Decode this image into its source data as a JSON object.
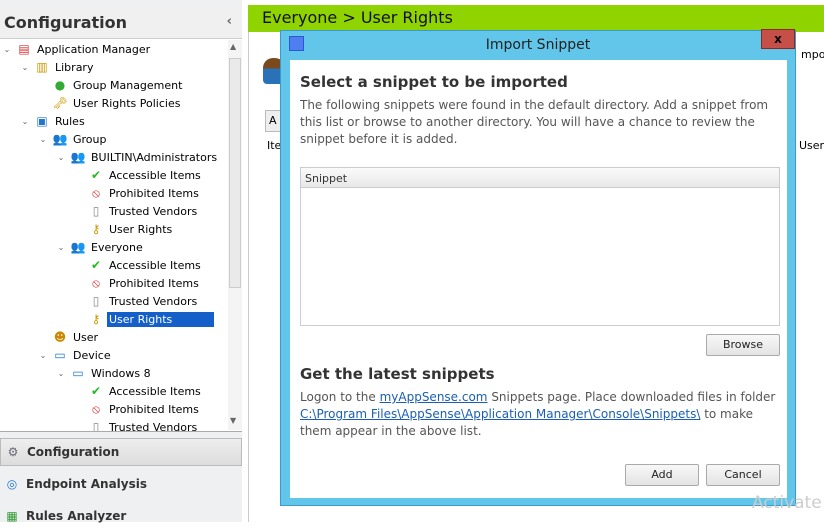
{
  "left_panel": {
    "title": "Configuration",
    "collapse_icon": "chevron-left-icon",
    "tree": [
      {
        "level": 0,
        "chev": true,
        "icon": "app-manager-icon",
        "label": "Application Manager"
      },
      {
        "level": 1,
        "chev": true,
        "icon": "library-icon",
        "label": "Library"
      },
      {
        "level": 2,
        "chev": false,
        "icon": "group-management-icon",
        "label": "Group Management"
      },
      {
        "level": 2,
        "chev": false,
        "icon": "user-rights-policies-icon",
        "label": "User Rights Policies"
      },
      {
        "level": 1,
        "chev": true,
        "icon": "rules-icon",
        "label": "Rules"
      },
      {
        "level": 2,
        "chev": true,
        "icon": "group-icon",
        "label": "Group"
      },
      {
        "level": 3,
        "chev": true,
        "icon": "group-icon",
        "label": "BUILTIN\\Administrators"
      },
      {
        "level": 4,
        "chev": false,
        "icon": "check-icon",
        "label": "Accessible Items"
      },
      {
        "level": 4,
        "chev": false,
        "icon": "prohibited-icon",
        "label": "Prohibited Items"
      },
      {
        "level": 4,
        "chev": false,
        "icon": "certificate-icon",
        "label": "Trusted Vendors"
      },
      {
        "level": 4,
        "chev": false,
        "icon": "user-key-icon",
        "label": "User Rights"
      },
      {
        "level": 3,
        "chev": true,
        "icon": "group-icon",
        "label": "Everyone"
      },
      {
        "level": 4,
        "chev": false,
        "icon": "check-icon",
        "label": "Accessible Items"
      },
      {
        "level": 4,
        "chev": false,
        "icon": "prohibited-icon",
        "label": "Prohibited Items"
      },
      {
        "level": 4,
        "chev": false,
        "icon": "certificate-icon",
        "label": "Trusted Vendors"
      },
      {
        "level": 4,
        "chev": false,
        "icon": "user-key-icon",
        "label": "User Rights",
        "selected": true
      },
      {
        "level": 2,
        "chev": false,
        "icon": "user-icon",
        "label": "User"
      },
      {
        "level": 2,
        "chev": true,
        "icon": "device-icon",
        "label": "Device"
      },
      {
        "level": 3,
        "chev": true,
        "icon": "device-icon",
        "label": "Windows 8"
      },
      {
        "level": 4,
        "chev": false,
        "icon": "check-icon",
        "label": "Accessible Items"
      },
      {
        "level": 4,
        "chev": false,
        "icon": "prohibited-icon",
        "label": "Prohibited Items"
      },
      {
        "level": 4,
        "chev": false,
        "icon": "certificate-icon",
        "label": "Trusted Vendors"
      }
    ],
    "nav": [
      {
        "icon": "gear-icon",
        "label": "Configuration",
        "active": true
      },
      {
        "icon": "endpoint-analysis-icon",
        "label": "Endpoint Analysis"
      },
      {
        "icon": "rules-analyzer-icon",
        "label": "Rules Analyzer"
      }
    ]
  },
  "main": {
    "breadcrumb": "Everyone > User Rights",
    "tab_fragment": "A",
    "col_item_fragment": "Ite",
    "col_user_fragment": "User",
    "import_fragment": "mpo"
  },
  "dialog": {
    "title": "Import Snippet",
    "close_label": "x",
    "heading1": "Select a snippet to be imported",
    "desc1": "The following snippets were found in the default directory.  Add a snippet from this list or browse to another directory.  You will have a chance to review the snippet before it is added.",
    "list_header": "Snippet",
    "browse": "Browse",
    "heading2": "Get the latest snippets",
    "desc2_a": "Logon to the ",
    "link1": "myAppSense.com",
    "desc2_b": " Snippets page. Place downloaded files in folder ",
    "link2": "C:\\Program Files\\AppSense\\Application Manager\\Console\\Snippets\\",
    "desc2_c": " to make them appear in the above list.",
    "add": "Add",
    "cancel": "Cancel"
  },
  "watermark": "Activate",
  "colors": {
    "green_bar": "#8fd400",
    "dialog_frame": "#62c6ea",
    "close_button": "#c65048",
    "selection": "#1460c8"
  }
}
